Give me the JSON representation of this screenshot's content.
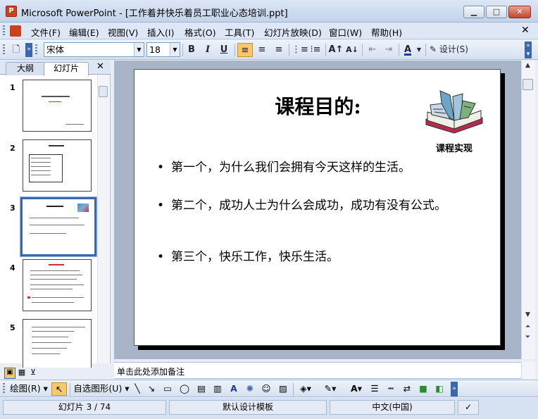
{
  "window": {
    "title": "Microsoft PowerPoint - [工作着并快乐着员工职业心态培训.ppt]",
    "app_icon_letter": "P",
    "minimize_glyph": "▭",
    "maximize_glyph": "□",
    "close_glyph": "✕"
  },
  "menu": {
    "items": [
      "文件(F)",
      "编辑(E)",
      "视图(V)",
      "插入(I)",
      "格式(O)",
      "工具(T)",
      "幻灯片放映(D)",
      "窗口(W)",
      "帮助(H)"
    ],
    "doc_close": "✕"
  },
  "toolbar": {
    "font_name": "宋体",
    "font_size": "18",
    "bold": "B",
    "italic": "I",
    "underline": "U",
    "design_label": "设计(S)",
    "font_color_letter": "A"
  },
  "left_pane": {
    "tab_outline": "大纲",
    "tab_slides": "幻灯片",
    "close": "✕",
    "thumbnails": [
      {
        "number": "1"
      },
      {
        "number": "2"
      },
      {
        "number": "3"
      },
      {
        "number": "4"
      },
      {
        "number": "5"
      }
    ],
    "selected_index": 3
  },
  "slide": {
    "title": "课程目的:",
    "image_caption": "课程实现",
    "bullets": [
      "第一个，为什么我们会拥有今天这样的生活。",
      "第二个，成功人士为什么会成功，成功有没有公式。",
      " 第三个，快乐工作，快乐生活。"
    ],
    "bullet_char": "•"
  },
  "notes": {
    "placeholder": "单击此处添加备注"
  },
  "draw_toolbar": {
    "draw_label": "绘图(R)",
    "autoshapes_label": "自选图形(U)"
  },
  "status": {
    "slide_info": "幻灯片 3 / 74",
    "template": "默认设计模板",
    "language": "中文(中国)"
  },
  "colors": {
    "accent": "#3a68b0",
    "slide_area": "#a8b4c8",
    "toolbar": "#d6e1f1"
  }
}
